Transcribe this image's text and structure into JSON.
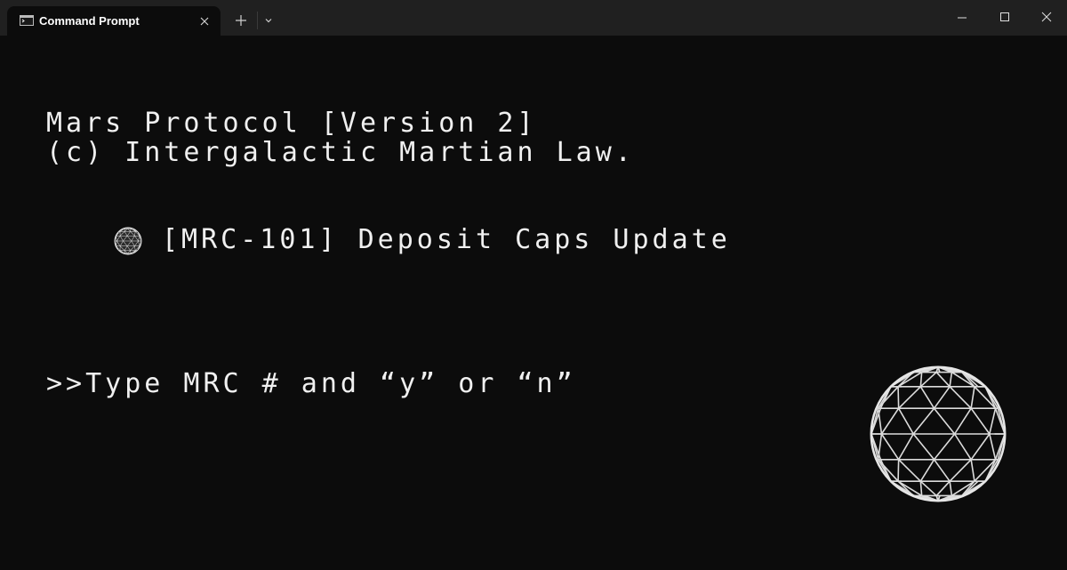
{
  "window": {
    "tab_title": "Command Prompt",
    "icons": {
      "tab": "terminal-icon",
      "close_tab": "close-icon",
      "new_tab": "plus-icon",
      "dropdown": "chevron-down-icon",
      "minimize": "minimize-icon",
      "maximize": "maximize-icon",
      "close": "close-icon"
    }
  },
  "console": {
    "header_line1": "Mars Protocol [Version 2]",
    "header_line2": "(c) Intergalactic Martian Law.",
    "proposal_title": "[MRC-101] Deposit Caps Update",
    "prompt": ">>Type MRC # and “y” or “n”",
    "proposal_icon": "geodesic-sphere-icon",
    "decoration_icon": "geodesic-sphere-icon"
  },
  "colors": {
    "titlebar": "#202020",
    "background": "#0c0c0c",
    "text": "#f0f0f0"
  }
}
